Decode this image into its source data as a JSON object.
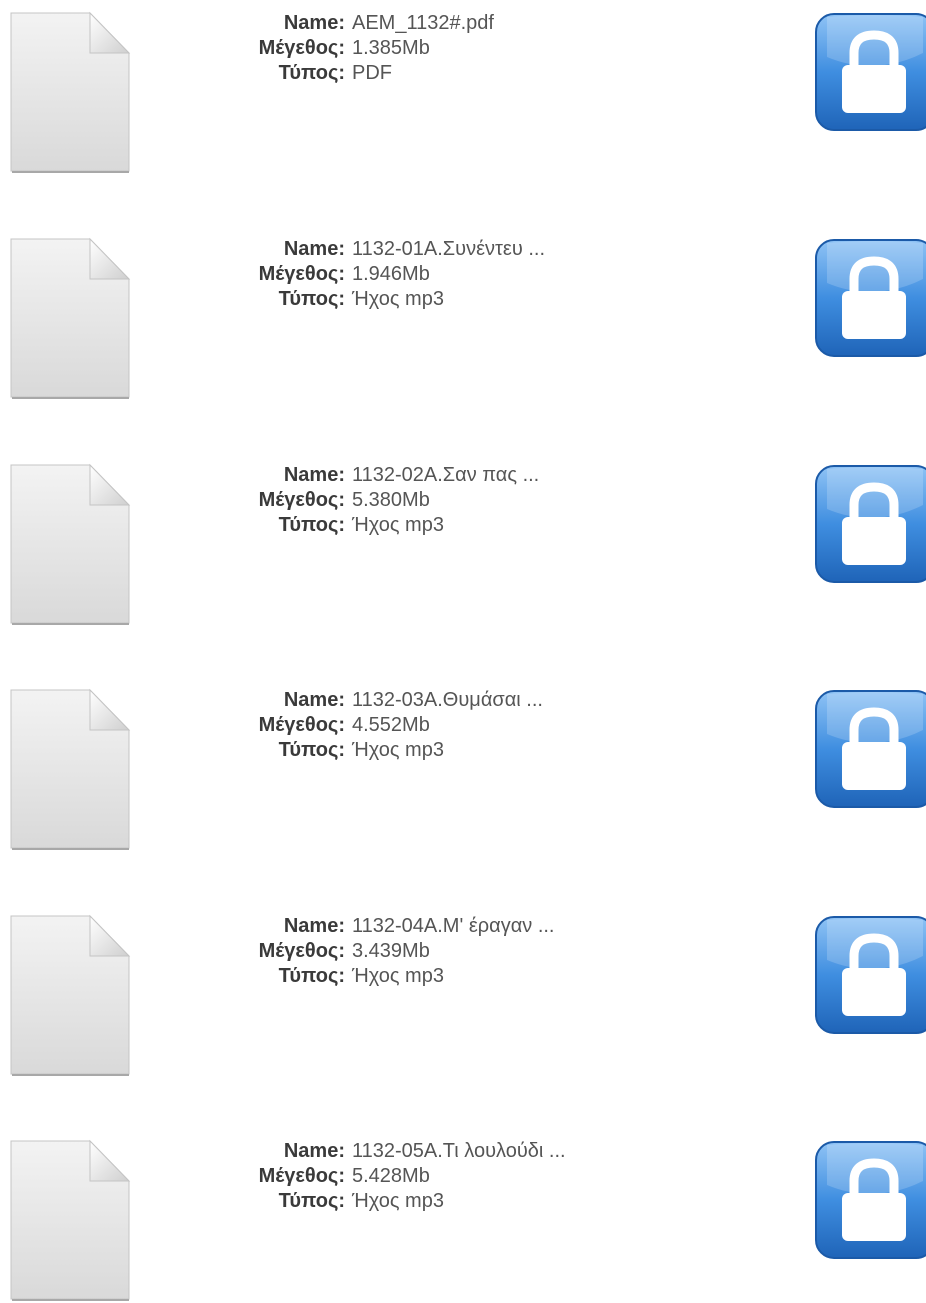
{
  "labels": {
    "name": "Name:",
    "size": "Μέγεθος:",
    "type": "Τύπος:"
  },
  "icons": {
    "file": "document-icon",
    "lock": "lock-icon"
  },
  "colors": {
    "lock_blue": "#3a86d8",
    "label_text": "#3a3a3a",
    "value_text": "#555555"
  },
  "files": [
    {
      "name": "AEM_1132#.pdf",
      "size": "1.385Mb",
      "type": "PDF"
    },
    {
      "name": "1132-01Α.Συνέντευ ...",
      "size": "1.946Mb",
      "type": "Ήχος mp3"
    },
    {
      "name": "1132-02Α.Σαν πας ...",
      "size": "5.380Mb",
      "type": "Ήχος mp3"
    },
    {
      "name": "1132-03Α.Θυμάσαι ...",
      "size": "4.552Mb",
      "type": "Ήχος mp3"
    },
    {
      "name": "1132-04Α.Μ' έραγαν ...",
      "size": "3.439Mb",
      "type": "Ήχος mp3"
    },
    {
      "name": "1132-05Α.Τι λουλούδι ...",
      "size": "5.428Mb",
      "type": "Ήχος mp3"
    }
  ]
}
